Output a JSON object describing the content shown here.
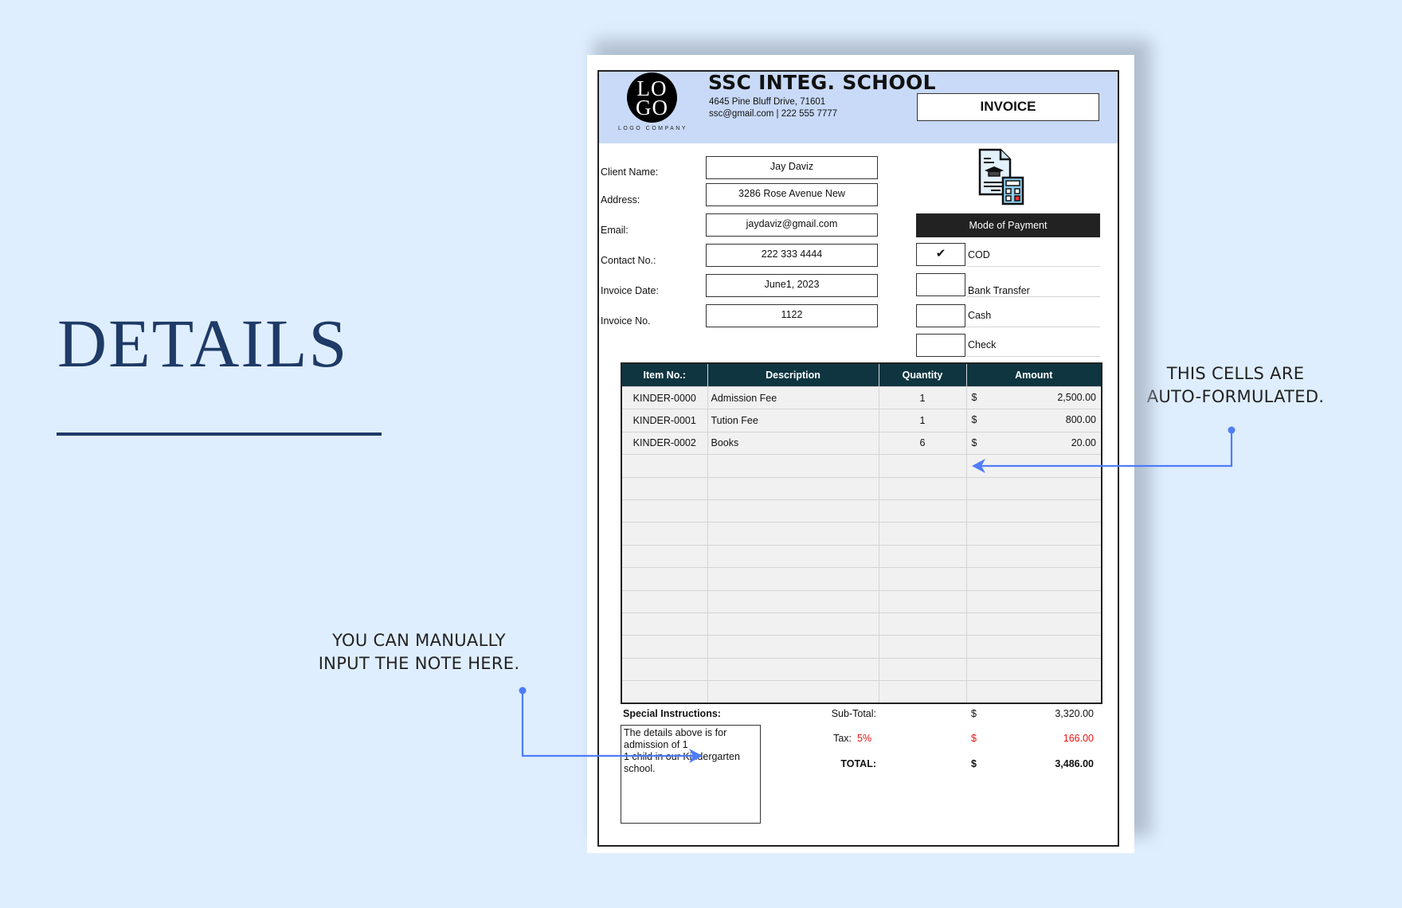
{
  "annotations": {
    "title": "DETAILS",
    "left_note": [
      "YOU CAN MANUALLY",
      "INPUT THE NOTE HERE."
    ],
    "right_note": [
      "THIS CELLS ARE",
      "AUTO-FORMULATED."
    ],
    "accent_color": "#4f7cf7",
    "title_color": "#1e3a66"
  },
  "invoice": {
    "logo": {
      "line1": "LO",
      "line2": "GO",
      "caption": "LOGO COMPANY"
    },
    "school_name": "SSC INTEG. SCHOOL",
    "address": "4645 Pine Bluff Drive, 71601",
    "contact": "ssc@gmail.com | 222 555 7777",
    "doc_title": "INVOICE",
    "header_bg": "#c9daf8",
    "client_fields": [
      {
        "label": "Client Name:",
        "value": "Jay Daviz"
      },
      {
        "label": "Address:",
        "value": "3286 Rose Avenue New"
      },
      {
        "label": "Email:",
        "value": "jaydaviz@gmail.com"
      },
      {
        "label": "Contact No.:",
        "value": "222 333 4444"
      },
      {
        "label": "Invoice Date:",
        "value": "June1, 2023"
      },
      {
        "label": "Invoice No.",
        "value": "1122"
      }
    ],
    "payment": {
      "title": "Mode of Payment",
      "options": [
        {
          "label": "COD",
          "checked": true,
          "mark": "✔"
        },
        {
          "label": "Bank Transfer",
          "checked": false,
          "mark": ""
        },
        {
          "label": "Cash",
          "checked": false,
          "mark": ""
        },
        {
          "label": "Check",
          "checked": false,
          "mark": ""
        }
      ]
    },
    "table": {
      "headers": [
        "Item No.:",
        "Description",
        "Quantity",
        "Amount"
      ],
      "header_bg": "#0e3540",
      "rows": [
        {
          "item": "KINDER-0000",
          "desc": "Admission Fee",
          "qty": "1",
          "cur": "$",
          "amount": "2,500.00"
        },
        {
          "item": "KINDER-0001",
          "desc": "Tution Fee",
          "qty": "1",
          "cur": "$",
          "amount": "800.00"
        },
        {
          "item": "KINDER-0002",
          "desc": "Books",
          "qty": "6",
          "cur": "$",
          "amount": "20.00"
        },
        {
          "item": "",
          "desc": "",
          "qty": "",
          "cur": "",
          "amount": ""
        },
        {
          "item": "",
          "desc": "",
          "qty": "",
          "cur": "",
          "amount": ""
        },
        {
          "item": "",
          "desc": "",
          "qty": "",
          "cur": "",
          "amount": ""
        },
        {
          "item": "",
          "desc": "",
          "qty": "",
          "cur": "",
          "amount": ""
        },
        {
          "item": "",
          "desc": "",
          "qty": "",
          "cur": "",
          "amount": ""
        },
        {
          "item": "",
          "desc": "",
          "qty": "",
          "cur": "",
          "amount": ""
        },
        {
          "item": "",
          "desc": "",
          "qty": "",
          "cur": "",
          "amount": ""
        },
        {
          "item": "",
          "desc": "",
          "qty": "",
          "cur": "",
          "amount": ""
        },
        {
          "item": "",
          "desc": "",
          "qty": "",
          "cur": "",
          "amount": ""
        },
        {
          "item": "",
          "desc": "",
          "qty": "",
          "cur": "",
          "amount": ""
        },
        {
          "item": "",
          "desc": "",
          "qty": "",
          "cur": "",
          "amount": ""
        }
      ]
    },
    "special_instructions": {
      "label": "Special Instructions:",
      "text_lines": [
        "The details above is for",
        "admission of 1",
        "1 child in our Kindergarten",
        "school."
      ]
    },
    "totals": {
      "subtotal_label": "Sub-Total:",
      "subtotal_cur": "$",
      "subtotal": "3,320.00",
      "tax_label": "Tax:",
      "tax_rate": "5%",
      "tax_cur": "$",
      "tax": "166.00",
      "total_label": "TOTAL:",
      "total_cur": "$",
      "total": "3,486.00",
      "tax_color": "#e11111"
    }
  }
}
